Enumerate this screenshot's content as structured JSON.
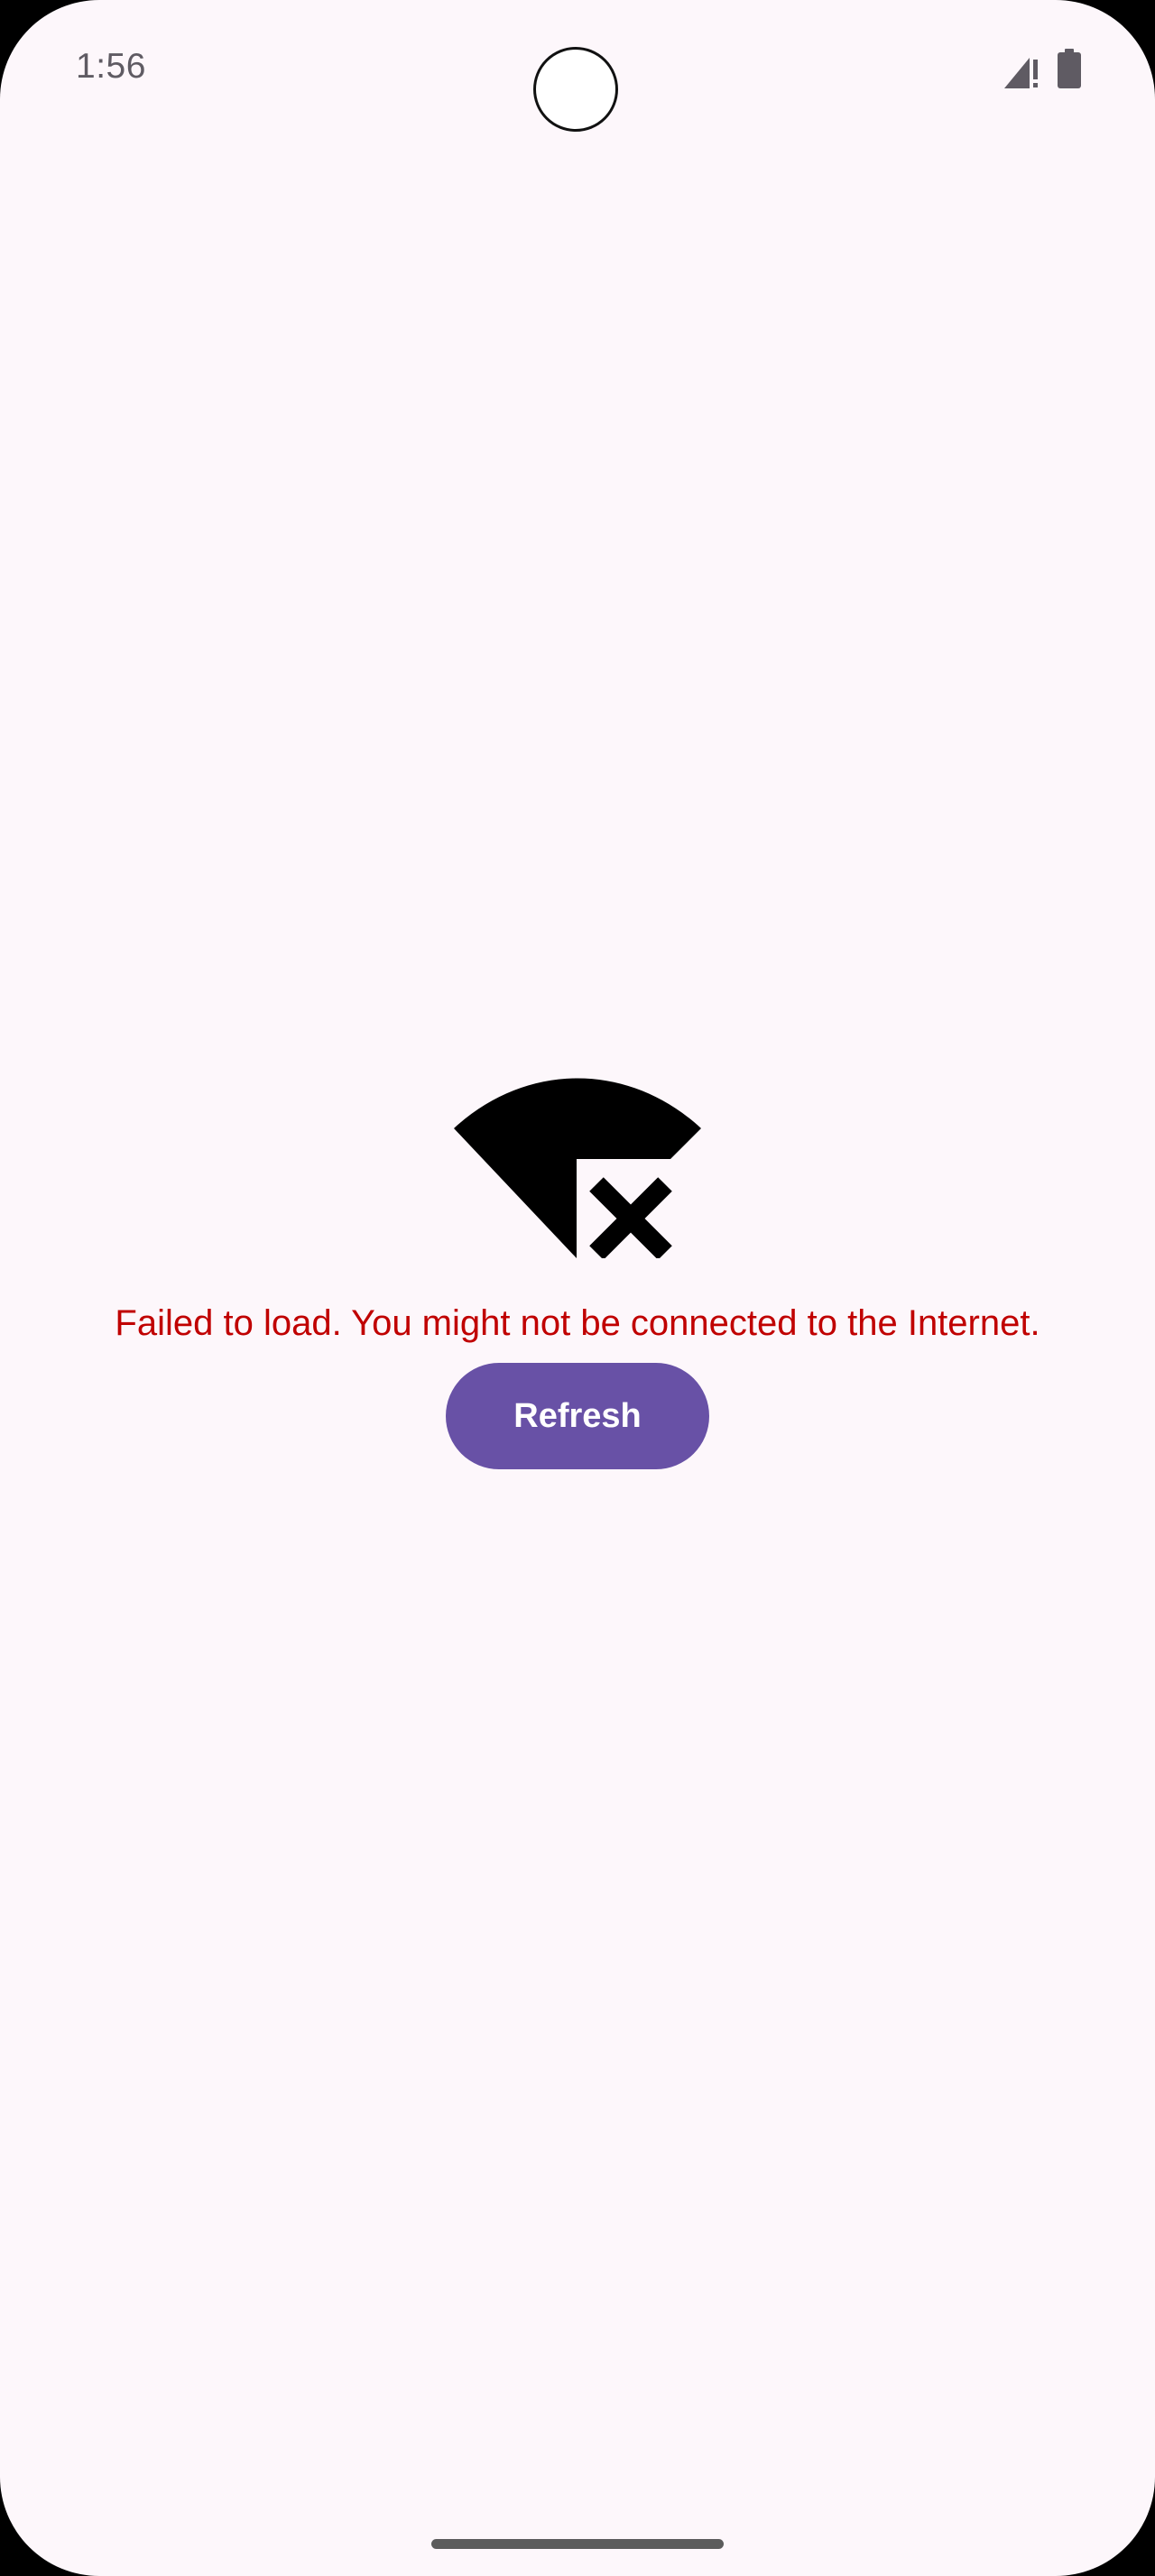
{
  "status_bar": {
    "time": "1:56",
    "signal_icon": "signal-no-data-icon",
    "battery_icon": "battery-full-icon"
  },
  "error_state": {
    "icon": "wifi-off-icon",
    "message": "Failed to load. You might not be connected to the Internet.",
    "refresh_label": "Refresh"
  },
  "colors": {
    "background": "#fdf7fb",
    "error_text": "#c00000",
    "button": "#6851a6",
    "button_text": "#ffffff"
  }
}
